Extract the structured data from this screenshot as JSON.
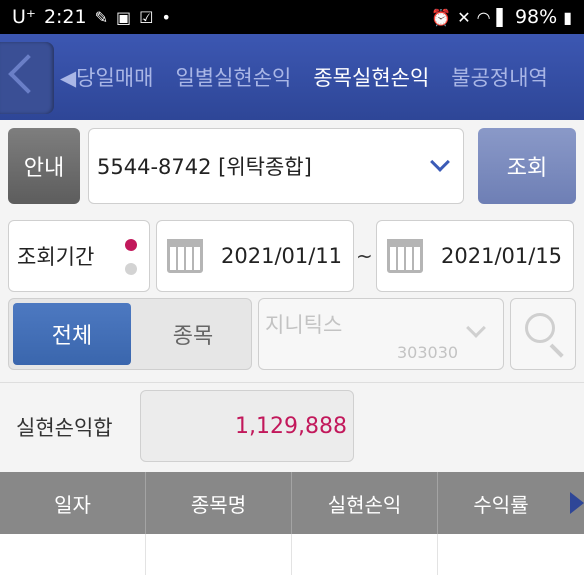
{
  "status_bar": {
    "carrier": "U⁺",
    "time": "2:21",
    "battery": "98%",
    "icons": [
      "bandage-icon",
      "voicemail-icon",
      "lte-icon",
      "dot-icon",
      "alarm-icon",
      "mute-icon",
      "wifi-icon",
      "signal-icon",
      "battery-icon"
    ]
  },
  "tabs": {
    "items": [
      {
        "label": "◀당일매매",
        "active": false
      },
      {
        "label": "일별실현손익",
        "active": false
      },
      {
        "label": "종목실현손익",
        "active": true
      },
      {
        "label": "불공정내역",
        "active": false
      }
    ]
  },
  "account": {
    "guide_label": "안내",
    "value": "5544-8742 [위탁종합]",
    "query_label": "조회"
  },
  "period": {
    "label": "조회기간",
    "start": "2021/01/11",
    "separator": "~",
    "end": "2021/01/15"
  },
  "filter": {
    "all_label": "전체",
    "stock_label": "종목",
    "stock_name": "지니틱스",
    "stock_code": "303030"
  },
  "summary": {
    "label": "실현손익합",
    "value": "1,129,888"
  },
  "table": {
    "headers": [
      "일자",
      "종목명",
      "실현손익",
      "수익률"
    ]
  },
  "colors": {
    "tab_bar": "#3c57b2",
    "accent_blue": "#3a66ad",
    "profit_red": "#c2185b",
    "header_gray": "#888888"
  }
}
